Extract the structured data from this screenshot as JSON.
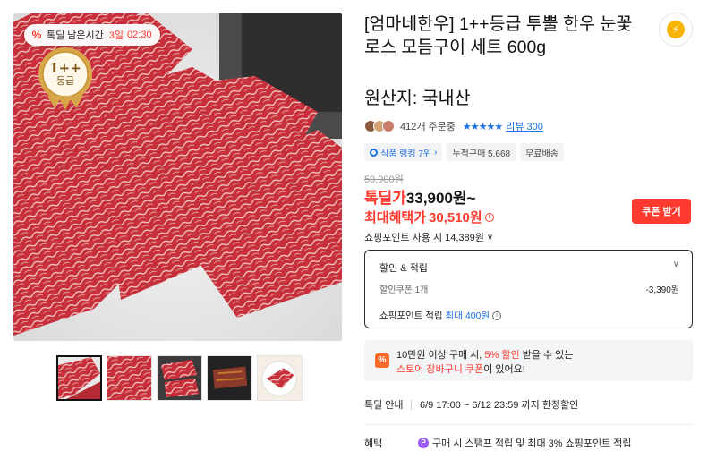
{
  "gallery": {
    "timer_label": "톡딜 남은시간",
    "timer_days": "3일",
    "timer_time": "02:30",
    "grade_line1": "1++",
    "grade_line2": "등급"
  },
  "product": {
    "title": "[엄마네한우] 1++등급 투뿔 한우 눈꽃로스 모듬구이 세트 600g",
    "origin": "원산지: 국내산",
    "order_count": "412개 주문중",
    "rating_stars": "★★★★★",
    "review_link": "리뷰 300",
    "chips": [
      "식품 랭킹 7위",
      "누적구매 5,668",
      "무료배송"
    ]
  },
  "pricing": {
    "original_price": "59,900원",
    "deal_label": "톡딜가",
    "deal_price": "33,900원~",
    "max_label": "최대혜택가",
    "max_price": "30,510원",
    "point_use": "쇼핑포인트 사용 시 14,389원",
    "coupon_button": "쿠폰 받기"
  },
  "benefits": {
    "header": "할인 & 적립",
    "coupon_label": "할인쿠폰 1개",
    "coupon_value": "-3,390원",
    "point_label": "쇼핑포인트 적립",
    "point_prefix": "최대",
    "point_value": "400원"
  },
  "promo": {
    "line1_prefix": "10만원 이상 구매 시,",
    "line1_highlight": "5% 할인",
    "line1_suffix": "받을 수 있는",
    "line2_highlight": "스토어 장바구니 쿠폰",
    "line2_suffix": "이 있어요!"
  },
  "deal_info": {
    "label": "톡딜 안내",
    "text": "6/9 17:00 ~ 6/12 23:59 까지 한정할인"
  },
  "benefit_row": {
    "label": "혜택",
    "text": "구매 시 스탬프 적립 및 최대 3% 쇼핑포인트 적립"
  },
  "colors": {
    "accent_red": "#ff3b2f",
    "link_blue": "#1f6fe5",
    "meat": "#c8343c"
  }
}
